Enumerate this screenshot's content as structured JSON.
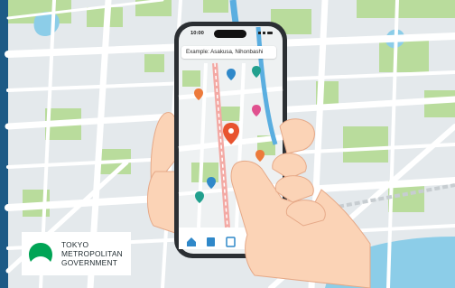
{
  "phone": {
    "status_time": "10:00",
    "search_placeholder": "Example: Asakusa, Nihonbashi"
  },
  "logo": {
    "line1": "TOKYO",
    "line2": "METROPOLITAN",
    "line3": "GOVERNMENT"
  },
  "colors": {
    "map_background": "#e4e9ec",
    "road": "#ffffff",
    "park": "#b9dc9c",
    "water": "#8ccde8",
    "river": "#5aaee0",
    "brand_green": "#00a455",
    "left_accent": "#1c5a86",
    "pin_orange": "#ec7a3b",
    "pin_blue": "#2f88c9",
    "pin_teal": "#22a08e",
    "pin_pink": "#e0518f",
    "skin": "#fbd3b6"
  }
}
